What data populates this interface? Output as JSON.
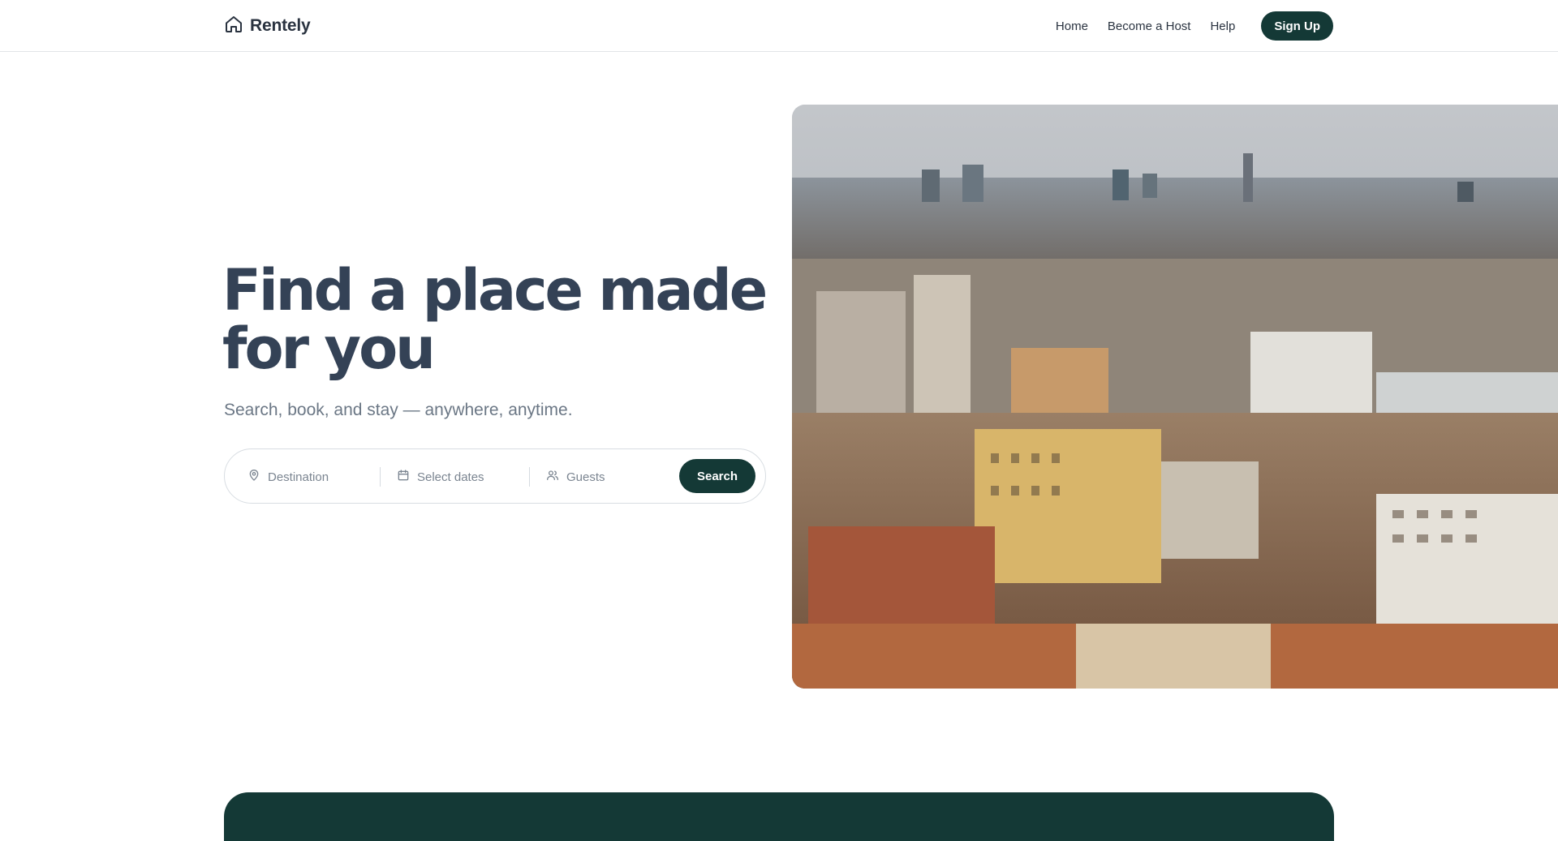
{
  "brand": {
    "name": "Rentely",
    "icon": "home-icon"
  },
  "nav": {
    "items": [
      {
        "label": "Home"
      },
      {
        "label": "Become a Host"
      },
      {
        "label": "Help"
      }
    ],
    "cta": "Sign Up"
  },
  "hero": {
    "title_line1": "Find a place made",
    "title_line2": "for you",
    "subtitle": "Search, book, and stay — anywhere, anytime.",
    "image_subject": "aerial city skyline"
  },
  "search": {
    "destination_placeholder": "Destination",
    "dates_placeholder": "Select dates",
    "guests_placeholder": "Guests",
    "button": "Search",
    "icons": [
      "map-pin-icon",
      "calendar-icon",
      "users-icon"
    ]
  },
  "colors": {
    "primary": "#143936",
    "heading": "#344256",
    "muted": "#6b7785",
    "border": "#d8dde2"
  }
}
